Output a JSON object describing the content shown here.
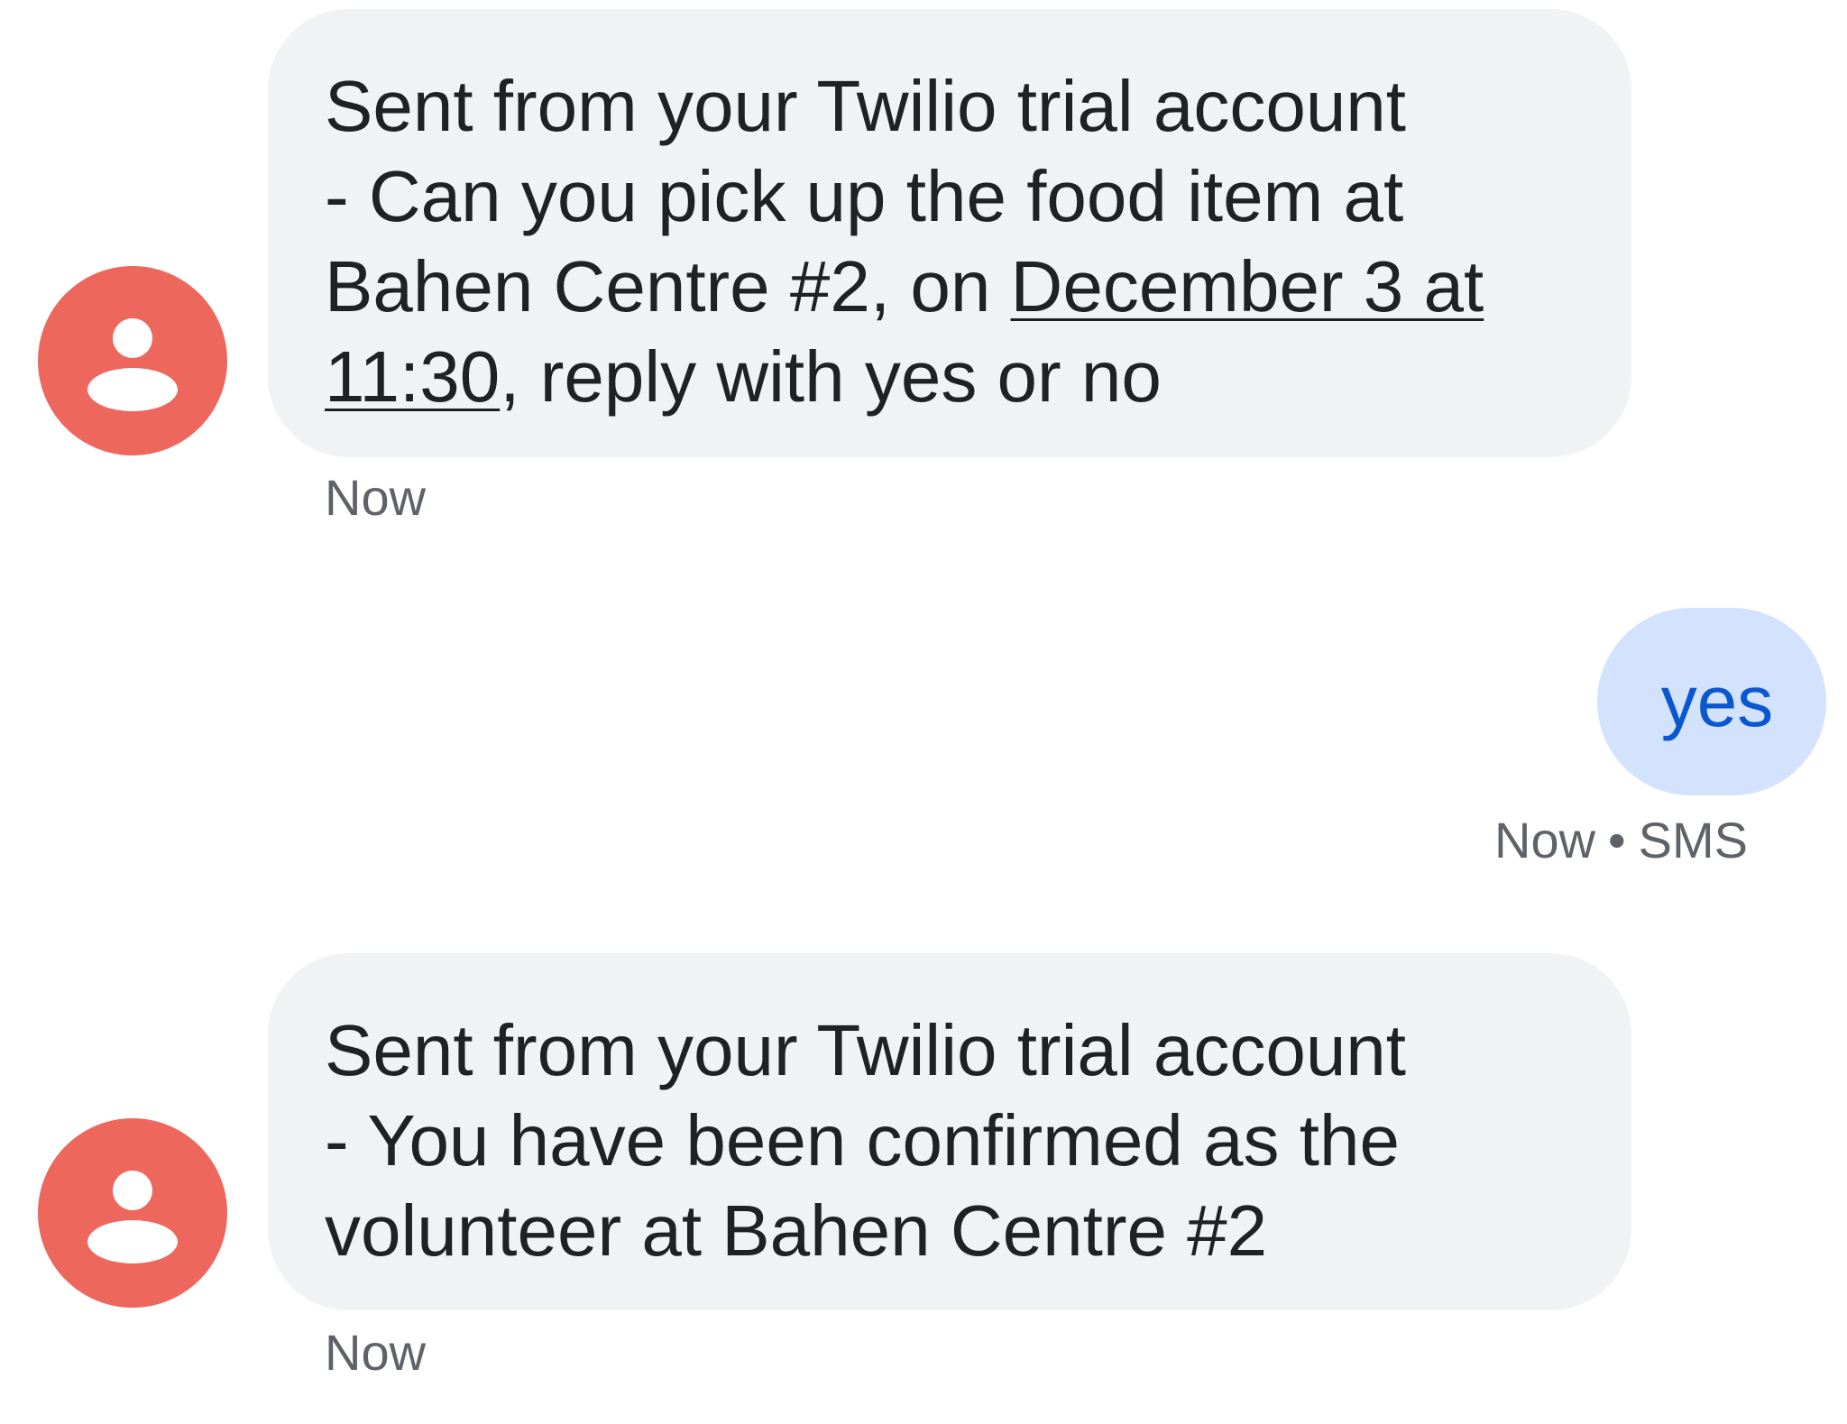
{
  "messages": [
    {
      "direction": "incoming",
      "avatar_icon": "person-icon",
      "avatar_color": "#ed675c",
      "lines": [
        "Sent from your Twilio trial account",
        "- Can you pick up the food item at"
      ],
      "line3_prefix": "Bahen Centre #2, on ",
      "date_link_part1": "December 3 at",
      "date_link_part2": "11:30",
      "line4_suffix": ", reply with yes or no",
      "timestamp": "Now"
    },
    {
      "direction": "outgoing",
      "text": "yes",
      "timestamp": "Now",
      "separator": "•",
      "channel": "SMS",
      "bubble_color": "#d3e3fd",
      "text_color": "#0b57d0"
    },
    {
      "direction": "incoming",
      "avatar_icon": "person-icon",
      "avatar_color": "#ed675c",
      "lines": [
        "Sent from your Twilio trial account",
        "- You have been confirmed as the",
        "volunteer at Bahen Centre #2"
      ],
      "timestamp": "Now"
    }
  ],
  "colors": {
    "incoming_bubble": "#f1f2f4",
    "incoming_text": "#202124",
    "meta_text": "#5f6368"
  }
}
